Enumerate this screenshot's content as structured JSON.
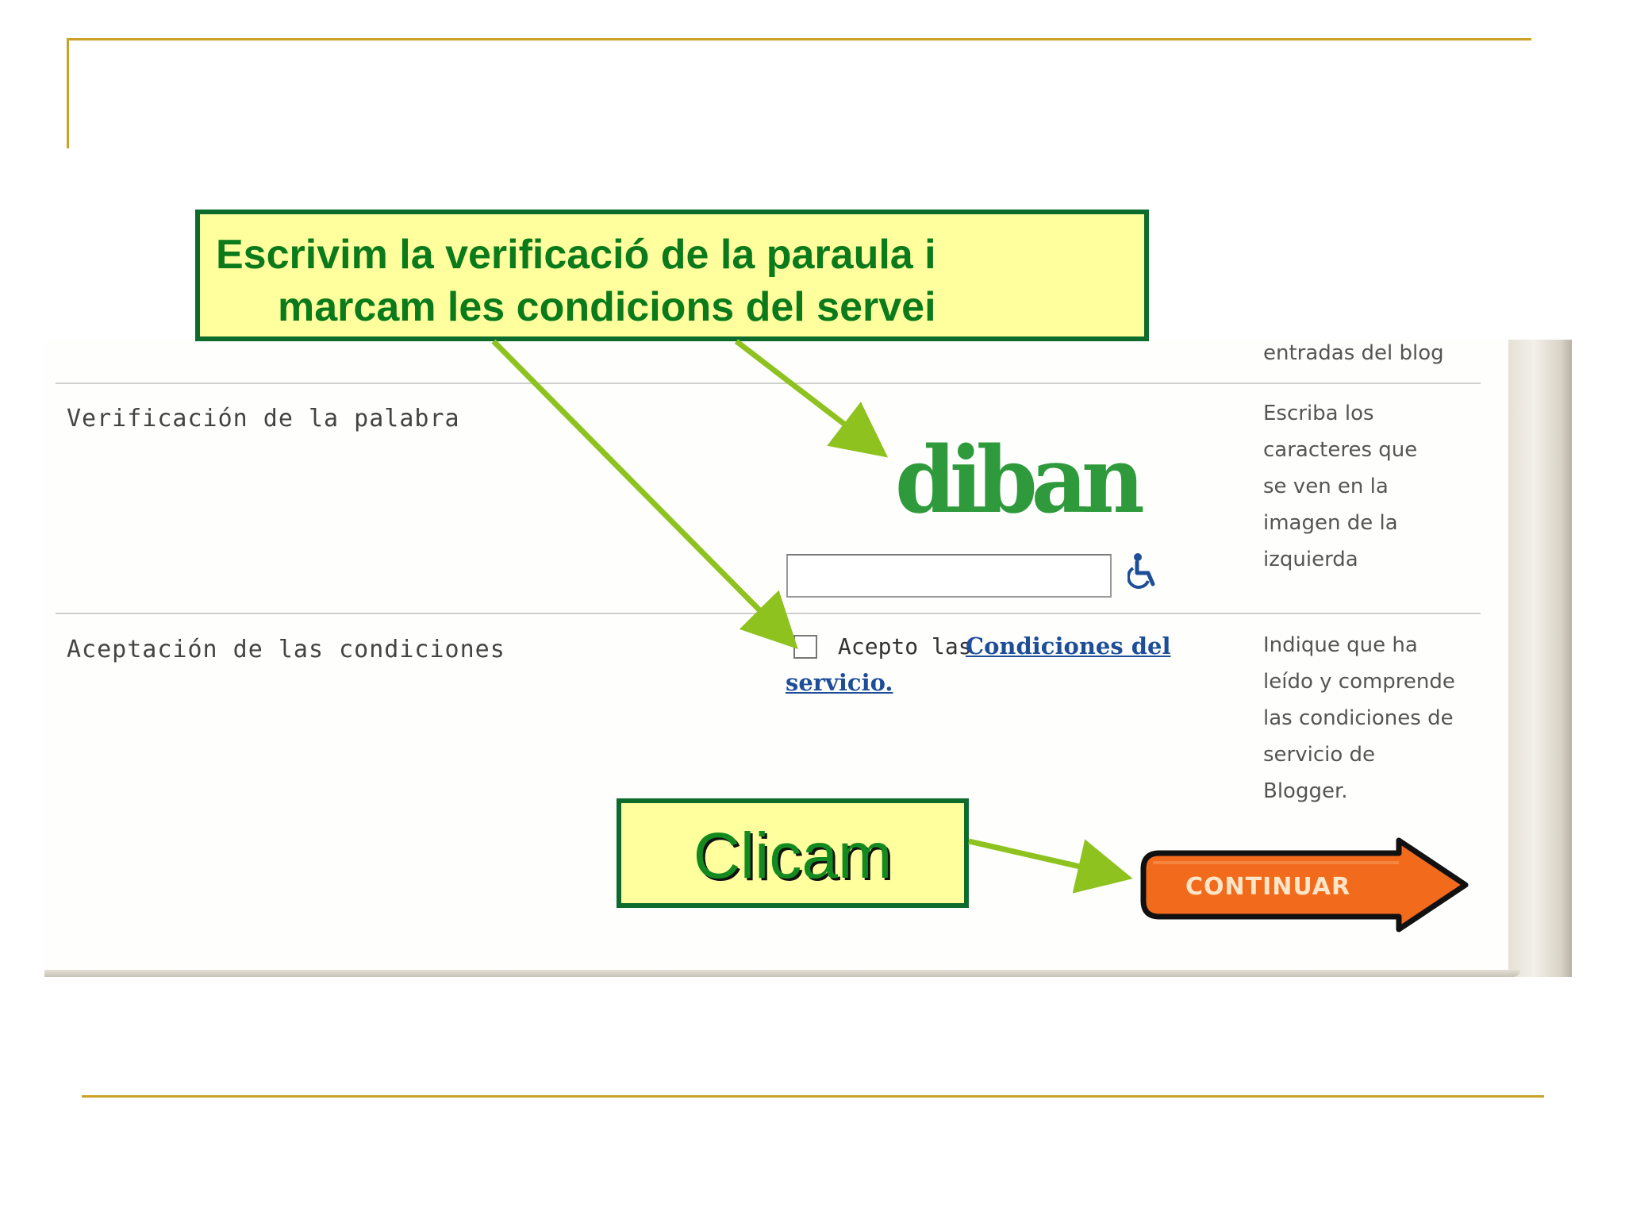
{
  "callouts": {
    "instruction_line1": "Escrivim la verificació de la paraula i",
    "instruction_line2": "marcam les condicions del servei",
    "click_label": "Clicam"
  },
  "form": {
    "top_help_fragment": "entradas del blog",
    "verification": {
      "label": "Verificación de la palabra",
      "captcha_word": "diban",
      "input_value": "",
      "help_lines": [
        "Escriba los",
        "caracteres que",
        "se ven en la",
        "imagen de la",
        "izquierda"
      ]
    },
    "terms": {
      "label": "Aceptación de las condiciones",
      "accept_text": "Acepto las",
      "link_line1": "Condiciones del",
      "link_line2": "servicio.",
      "checked": false,
      "help_lines": [
        "Indique que ha",
        "leído y comprende",
        "las condiciones de",
        "servicio de",
        "Blogger."
      ]
    },
    "continue_label": "CONTINUAR"
  },
  "colors": {
    "callout_fill": "#ffff9d",
    "callout_border": "#0d6b2b",
    "callout_text": "#0a7a1b",
    "arrow": "#8dc21f",
    "rule": "#c9a227",
    "continue_fill": "#f26b1d",
    "link": "#1f4e98",
    "captcha": "#2f9a3c"
  },
  "icons": {
    "accessibility": "wheelchair-icon",
    "continue": "arrow-right-icon"
  }
}
